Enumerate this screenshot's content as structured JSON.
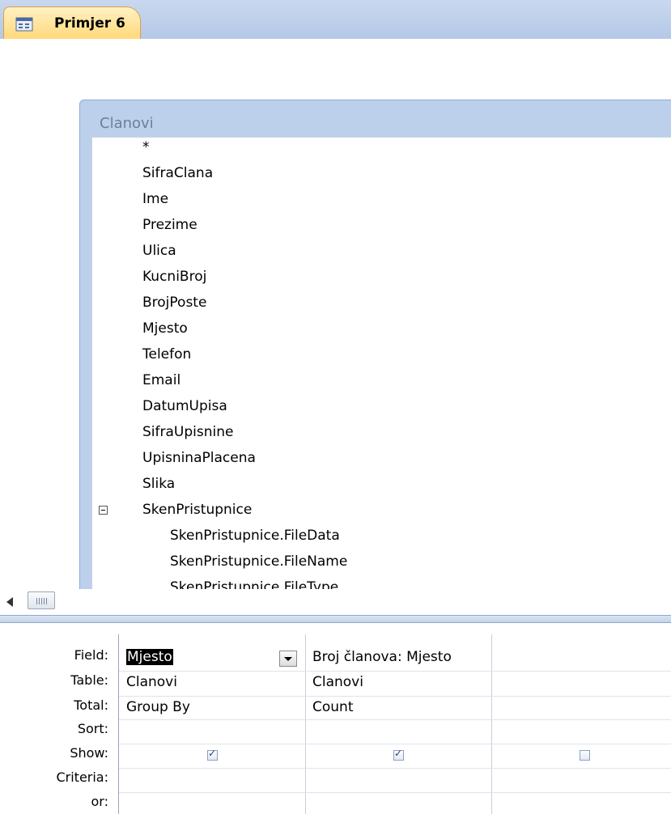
{
  "tab": {
    "title": "Primjer 6",
    "icon": "query-icon"
  },
  "field_list": {
    "table_name": "Clanovi",
    "fields": [
      "*",
      "SifraClana",
      "Ime",
      "Prezime",
      "Ulica",
      "KucniBroj",
      "BrojPoste",
      "Mjesto",
      "Telefon",
      "Email",
      "DatumUpisa",
      "SifraUpisnine",
      "UpisninaPlacena",
      "Slika",
      "SkenPristupnice"
    ],
    "sub_fields": [
      "SkenPristupnice.FileData",
      "SkenPristupnice.FileName",
      "SkenPristupnice.FileType"
    ]
  },
  "grid": {
    "row_labels": [
      "Field:",
      "Table:",
      "Total:",
      "Sort:",
      "Show:",
      "Criteria:",
      "or:"
    ],
    "columns": [
      {
        "field": "Mjesto",
        "table": "Clanovi",
        "total": "Group By",
        "sort": "",
        "show": true,
        "criteria": ""
      },
      {
        "field": "Broj članova: Mjesto",
        "table": "Clanovi",
        "total": "Count",
        "sort": "",
        "show": true,
        "criteria": ""
      },
      {
        "field": "",
        "table": "",
        "total": "",
        "sort": "",
        "show": false,
        "criteria": ""
      }
    ]
  },
  "colors": {
    "tab_active": "#ffd97a",
    "field_list_frame": "#bcd0ec",
    "accent": "#9fb4d6"
  }
}
